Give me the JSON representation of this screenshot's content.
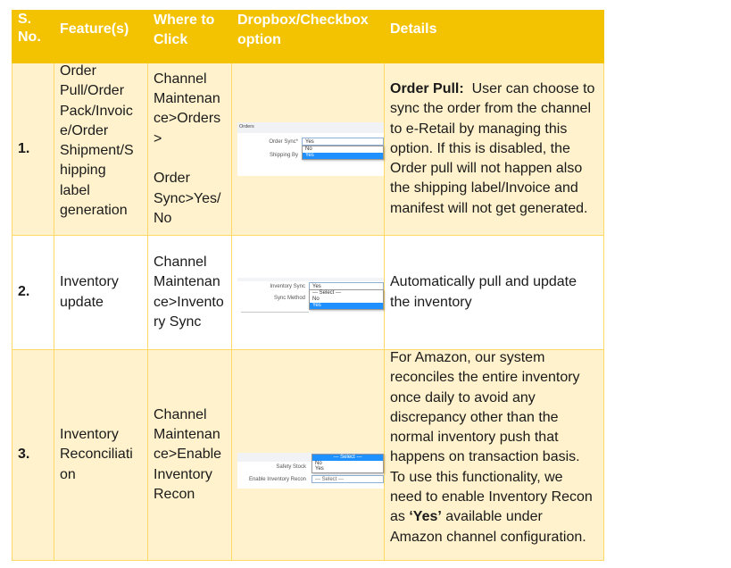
{
  "header": {
    "sno": [
      "S.",
      "No."
    ],
    "feature": "Feature(s)",
    "where": [
      "Where to",
      "Click"
    ],
    "dropdown": [
      "Dropbox/Checkbox",
      "option"
    ],
    "details": "Details"
  },
  "colors": {
    "header_bg": "#F3C200",
    "header_text": "#FFFFFF",
    "row_cream": "#FFF2CC",
    "border": "#FFD966",
    "highlight_option": "#1E90FF"
  },
  "rows": [
    {
      "sno": "1.",
      "feature_lines": [
        "Order",
        "Pull/Order",
        "Pack/Invoic",
        "e/Order",
        "Shipment/S",
        "hipping",
        "label",
        "generation"
      ],
      "where_lines": [
        "Channel",
        "Maintenan",
        "ce>Orders",
        ">",
        "",
        "Order",
        "Sync>Yes/",
        "No"
      ],
      "screenshot": {
        "section_title": "Orders",
        "fields": [
          {
            "label": "Order Sync*",
            "value": "Yes"
          },
          {
            "label": "Shipping By",
            "value": ""
          }
        ],
        "dropdown_options": [
          "No",
          "Yes"
        ],
        "highlighted_option": "Yes"
      },
      "details": {
        "bold_lead": "Order Pull:",
        "text": "  User can choose to sync the order from the channel to e-Retail by managing this option. If this is disabled, the Order pull will not happen also the shipping label/Invoice and manifest will not get generated."
      }
    },
    {
      "sno": "2.",
      "feature_lines": [
        "Inventory",
        "update"
      ],
      "where_lines": [
        "Channel",
        "Maintenan",
        "ce>Invento",
        "ry Sync"
      ],
      "screenshot": {
        "fields": [
          {
            "label": "Inventory Sync",
            "value": "Yes"
          },
          {
            "label": "Sync Method",
            "value": ""
          }
        ],
        "dropdown_options": [
          "--- Select ---",
          "No",
          "Yes"
        ],
        "highlighted_option": "Yes"
      },
      "details": {
        "text": "Automatically pull and update the inventory"
      }
    },
    {
      "sno": "3.",
      "feature_lines": [
        "Inventory",
        "Reconciliati",
        "on"
      ],
      "where_lines": [
        "Channel",
        "Maintenan",
        "ce>Enable",
        "Inventory",
        "Recon"
      ],
      "screenshot": {
        "fields": [
          {
            "label": "Safety Stock",
            "value": ""
          },
          {
            "label": "Enable Inventory Recon",
            "value": "--- Select ---"
          }
        ],
        "dropdown_options": [
          "--- Select ---",
          "No",
          "Yes"
        ],
        "highlighted_option": "--- Select ---"
      },
      "details": {
        "text_before": "For Amazon, our system reconciles the entire inventory once daily to avoid any discrepancy other than the normal inventory push that happens on transaction basis. To use this functionality, we need to enable Inventory Recon as ",
        "bold": "‘Yes’",
        "text_after": " available under Amazon channel configuration."
      }
    }
  ]
}
